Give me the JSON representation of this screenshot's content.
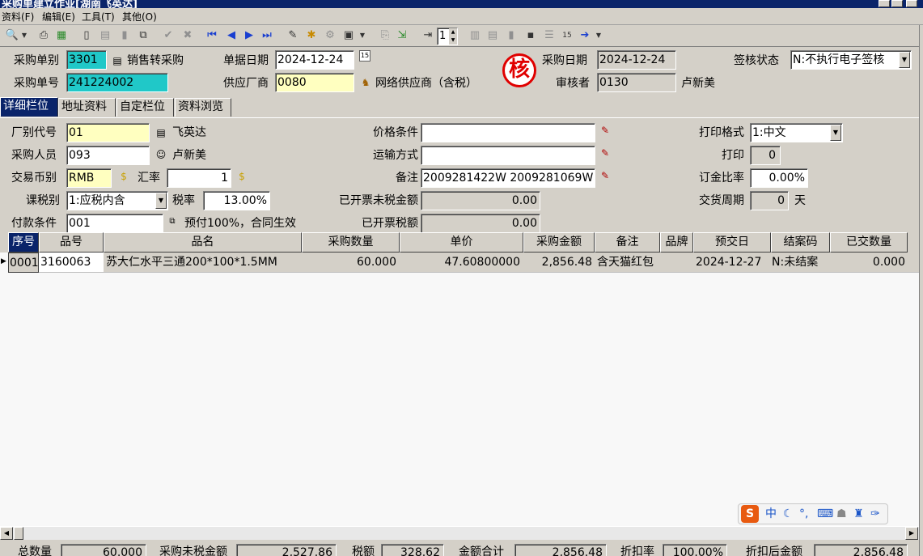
{
  "window": {
    "title": "采购单建立作业[湖南飞英达]"
  },
  "menu": [
    "资料(F)",
    "编辑(E)",
    "工具(T)",
    "其他(O)"
  ],
  "toolbar": {
    "page_number": "1"
  },
  "header": {
    "order_type_label": "采购单别",
    "order_type_value": "3301",
    "order_type_name": "销售转采购",
    "order_no_label": "采购单号",
    "order_no_value": "241224002",
    "doc_date_label": "单据日期",
    "doc_date_value": "2024-12-24",
    "supplier_label": "供应厂商",
    "supplier_value": "0080",
    "supplier_name": "网络供应商（含税）",
    "purchase_date_label": "采购日期",
    "purchase_date_value": "2024-12-24",
    "reviewer_label": "审核者",
    "reviewer_value": "0130",
    "reviewer_name": "卢新美",
    "sign_status_label": "签核状态",
    "sign_status_value": "N:不执行电子签核",
    "seal_text": "核"
  },
  "tabs": [
    "详细栏位",
    "地址资料",
    "自定栏位",
    "资料浏览"
  ],
  "detail": {
    "factory_label": "厂别代号",
    "factory_value": "01",
    "factory_name": "飞英达",
    "buyer_label": "采购人员",
    "buyer_value": "093",
    "buyer_name": "卢新美",
    "currency_label": "交易币别",
    "currency_value": "RMB",
    "rate_label": "汇率",
    "rate_value": "1",
    "tax_type_label": "课税别",
    "tax_type_value": "1:应税内含",
    "tax_rate_label": "税率",
    "tax_rate_value": "13.00%",
    "payment_label": "付款条件",
    "payment_value": "001",
    "payment_desc": "预付100%，合同生效",
    "price_cond_label": "价格条件",
    "price_cond_value": "",
    "shipping_label": "运输方式",
    "shipping_value": "",
    "remark_label": "备注",
    "remark_value": "2009281422W 2009281069W",
    "invoiced_untaxed_label": "已开票未税金额",
    "invoiced_untaxed_value": "0.00",
    "invoiced_tax_label": "已开票税额",
    "invoiced_tax_value": "0.00",
    "print_format_label": "打印格式",
    "print_format_value": "1:中文",
    "print_label": "打印",
    "print_value": "0",
    "deposit_label": "订金比率",
    "deposit_value": "0.00%",
    "delivery_label": "交货周期",
    "delivery_value": "0",
    "delivery_unit": "天"
  },
  "grid": {
    "columns": [
      "序号",
      "品号",
      "品名",
      "采购数量",
      "单价",
      "采购金额",
      "备注",
      "品牌",
      "预交日",
      "结案码",
      "已交数量"
    ],
    "rows": [
      [
        "0001",
        "3160063",
        "苏大仁水平三通200*100*1.5MM",
        "60.000",
        "47.60800000",
        "2,856.48",
        "含天猫红包",
        "",
        "2024-12-27",
        "N:未结案",
        "0.000"
      ]
    ]
  },
  "footer": {
    "total_qty_label": "总数量",
    "total_qty_value": "60.000",
    "untaxed_label": "采购未税金额",
    "untaxed_value": "2,527.86",
    "tax_label": "税额",
    "tax_value": "328.62",
    "total_label": "金额合计",
    "total_value": "2,856.48",
    "discount_label": "折扣率",
    "discount_value": "100.00%",
    "after_discount_label": "折扣后金额",
    "after_discount_value": "2,856.48"
  },
  "ime": {
    "logo": "S",
    "lang": "中"
  }
}
